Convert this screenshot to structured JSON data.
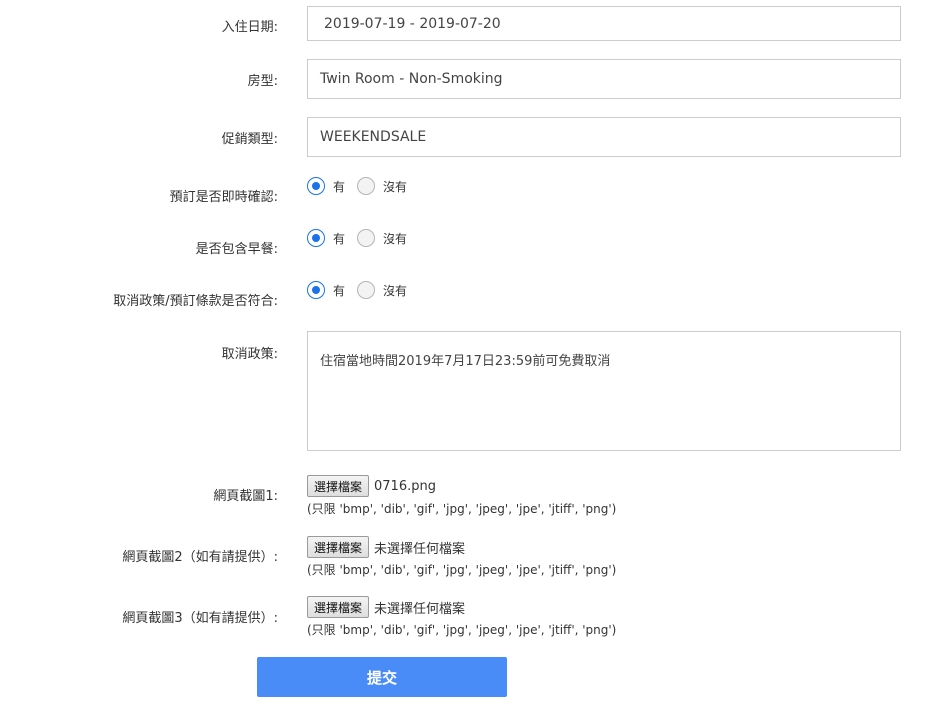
{
  "form": {
    "checkin": {
      "label": "入住日期:",
      "value": "2019-07-19 - 2019-07-20"
    },
    "room_type": {
      "label": "房型:",
      "value": "Twin Room - Non-Smoking"
    },
    "promo_type": {
      "label": "促銷類型:",
      "value": "WEEKENDSALE"
    },
    "instant_confirm": {
      "label": "預訂是否即時確認:",
      "yes": "有",
      "no": "沒有",
      "selected": "yes"
    },
    "breakfast": {
      "label": "是否包含早餐:",
      "yes": "有",
      "no": "沒有",
      "selected": "yes"
    },
    "cancel_match": {
      "label": "取消政策/預訂條款是否符合:",
      "yes": "有",
      "no": "沒有",
      "selected": "yes"
    },
    "cancel_policy": {
      "label": "取消政策:",
      "value": "住宿當地時間2019年7月17日23:59前可免費取消"
    },
    "screenshot1": {
      "label": "網頁截圖1:",
      "button": "選擇檔案",
      "file": "0716.png",
      "hint": "(只限 'bmp', 'dib', 'gif', 'jpg', 'jpeg', 'jpe', 'jtiff', 'png')"
    },
    "screenshot2": {
      "label": "網頁截圖2（如有請提供）:",
      "button": "選擇檔案",
      "file": "未選擇任何檔案",
      "hint": "(只限 'bmp', 'dib', 'gif', 'jpg', 'jpeg', 'jpe', 'jtiff', 'png')"
    },
    "screenshot3": {
      "label": "網頁截圖3（如有請提供）:",
      "button": "選擇檔案",
      "file": "未選擇任何檔案",
      "hint": "(只限 'bmp', 'dib', 'gif', 'jpg', 'jpeg', 'jpe', 'jtiff', 'png')"
    },
    "submit_label": "提交"
  },
  "colors": {
    "accent": "#1a73e8",
    "submit": "#4a8cf7",
    "border": "#cccccc"
  }
}
